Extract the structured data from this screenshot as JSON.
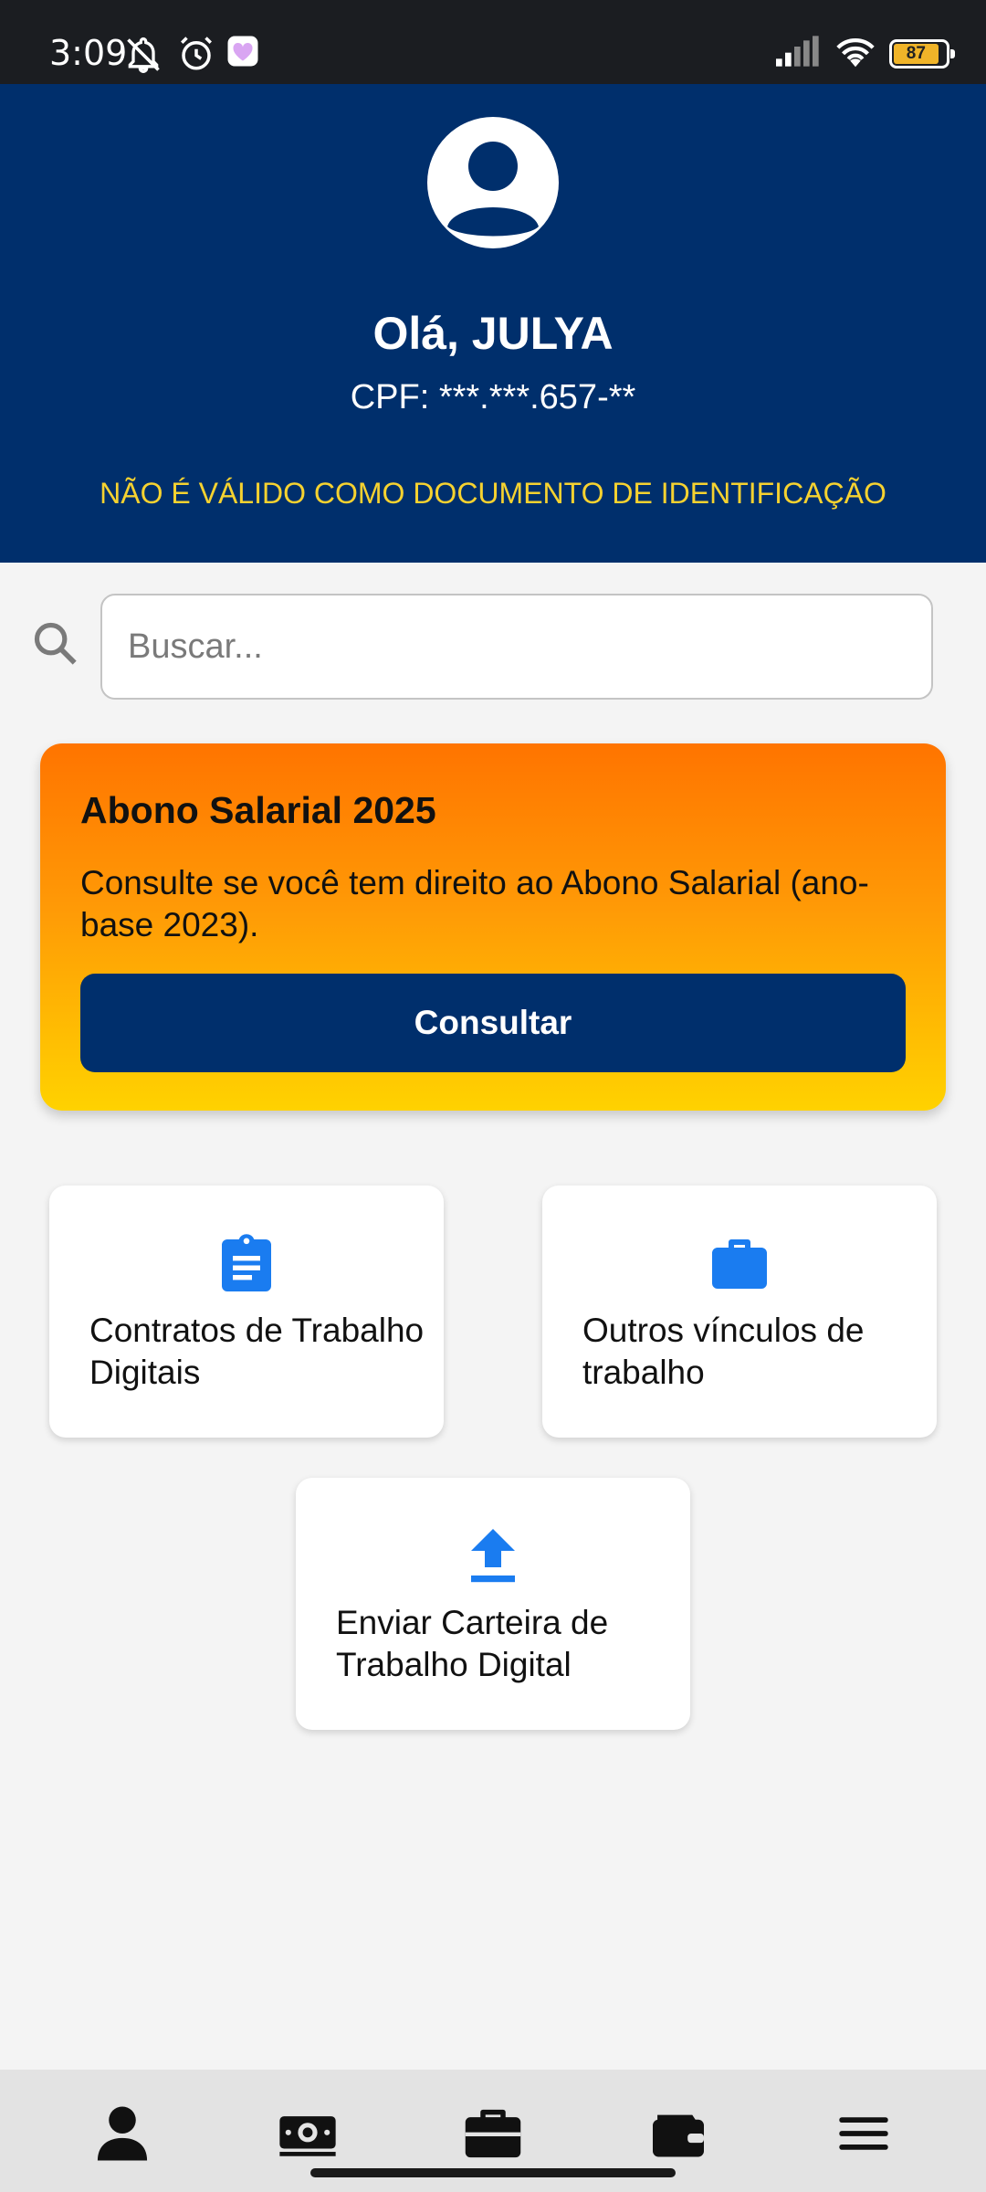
{
  "status_bar": {
    "time": "3:09",
    "battery_level": "87",
    "icons": [
      "notifications-off-icon",
      "alarm-icon",
      "app-notification-icon",
      "signal-icon",
      "wifi-icon",
      "battery-icon"
    ]
  },
  "header": {
    "greeting": "Olá, JULYA",
    "cpf": "CPF: ***.***.657-**",
    "warning": "NÃO É VÁLIDO COMO DOCUMENTO DE IDENTIFICAÇÃO"
  },
  "search": {
    "placeholder": "Buscar..."
  },
  "promo": {
    "title": "Abono Salarial 2025",
    "text": "Consulte se você tem direito ao Abono Salarial (ano-base 2023).",
    "button_label": "Consultar"
  },
  "tiles": [
    {
      "label": "Contratos de Trabalho Digitais",
      "icon": "clipboard-icon"
    },
    {
      "label": "Outros vínculos de trabalho",
      "icon": "briefcase-icon"
    },
    {
      "label": "Enviar Carteira de Trabalho Digital",
      "icon": "upload-icon"
    }
  ],
  "bottom_nav": [
    "person-icon",
    "money-icon",
    "briefcase-icon",
    "wallet-icon",
    "menu-icon"
  ],
  "colors": {
    "header_bg": "#002f6c",
    "warning_text": "#f6d230",
    "accent_icon": "#1a7cf0",
    "promo_gradient_top": "#ff7400",
    "promo_gradient_bottom": "#ffd200"
  }
}
